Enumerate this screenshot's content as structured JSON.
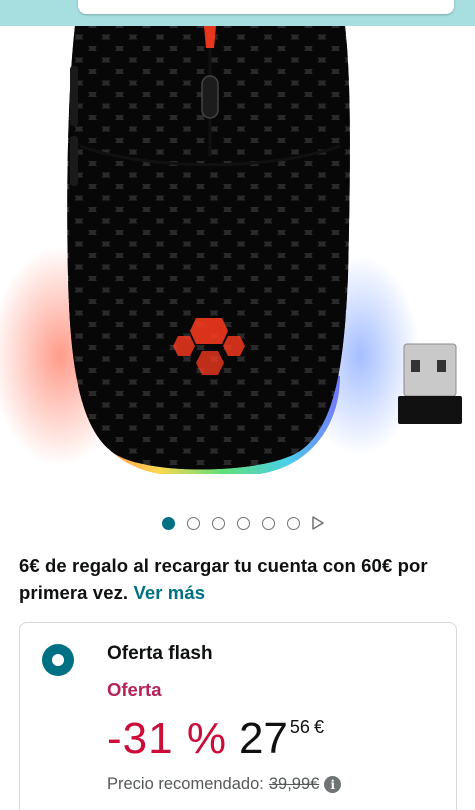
{
  "header": {
    "search_placeholder": ""
  },
  "product_image": {
    "alt_subject": "mouse-image",
    "accent": "#ff3b1f"
  },
  "carousel": {
    "image_count": 6,
    "active_index": 0,
    "has_video": true
  },
  "promo": {
    "text": "6€ de regalo al recargar tu cuenta con 60€ por primera vez.",
    "link": "Ver más"
  },
  "offer": {
    "title": "Oferta flash",
    "label": "Oferta",
    "discount": "-31 %",
    "price_whole": "27",
    "price_cents": "56",
    "currency": "€",
    "rrp_label": "Precio recomendado:",
    "rrp_value": "39,99€",
    "info_icon": "i"
  },
  "colors": {
    "link": "#007185",
    "discount": "#cc0c39",
    "offer_label": "#b4235a",
    "top_strip": "#a7dfe0"
  }
}
